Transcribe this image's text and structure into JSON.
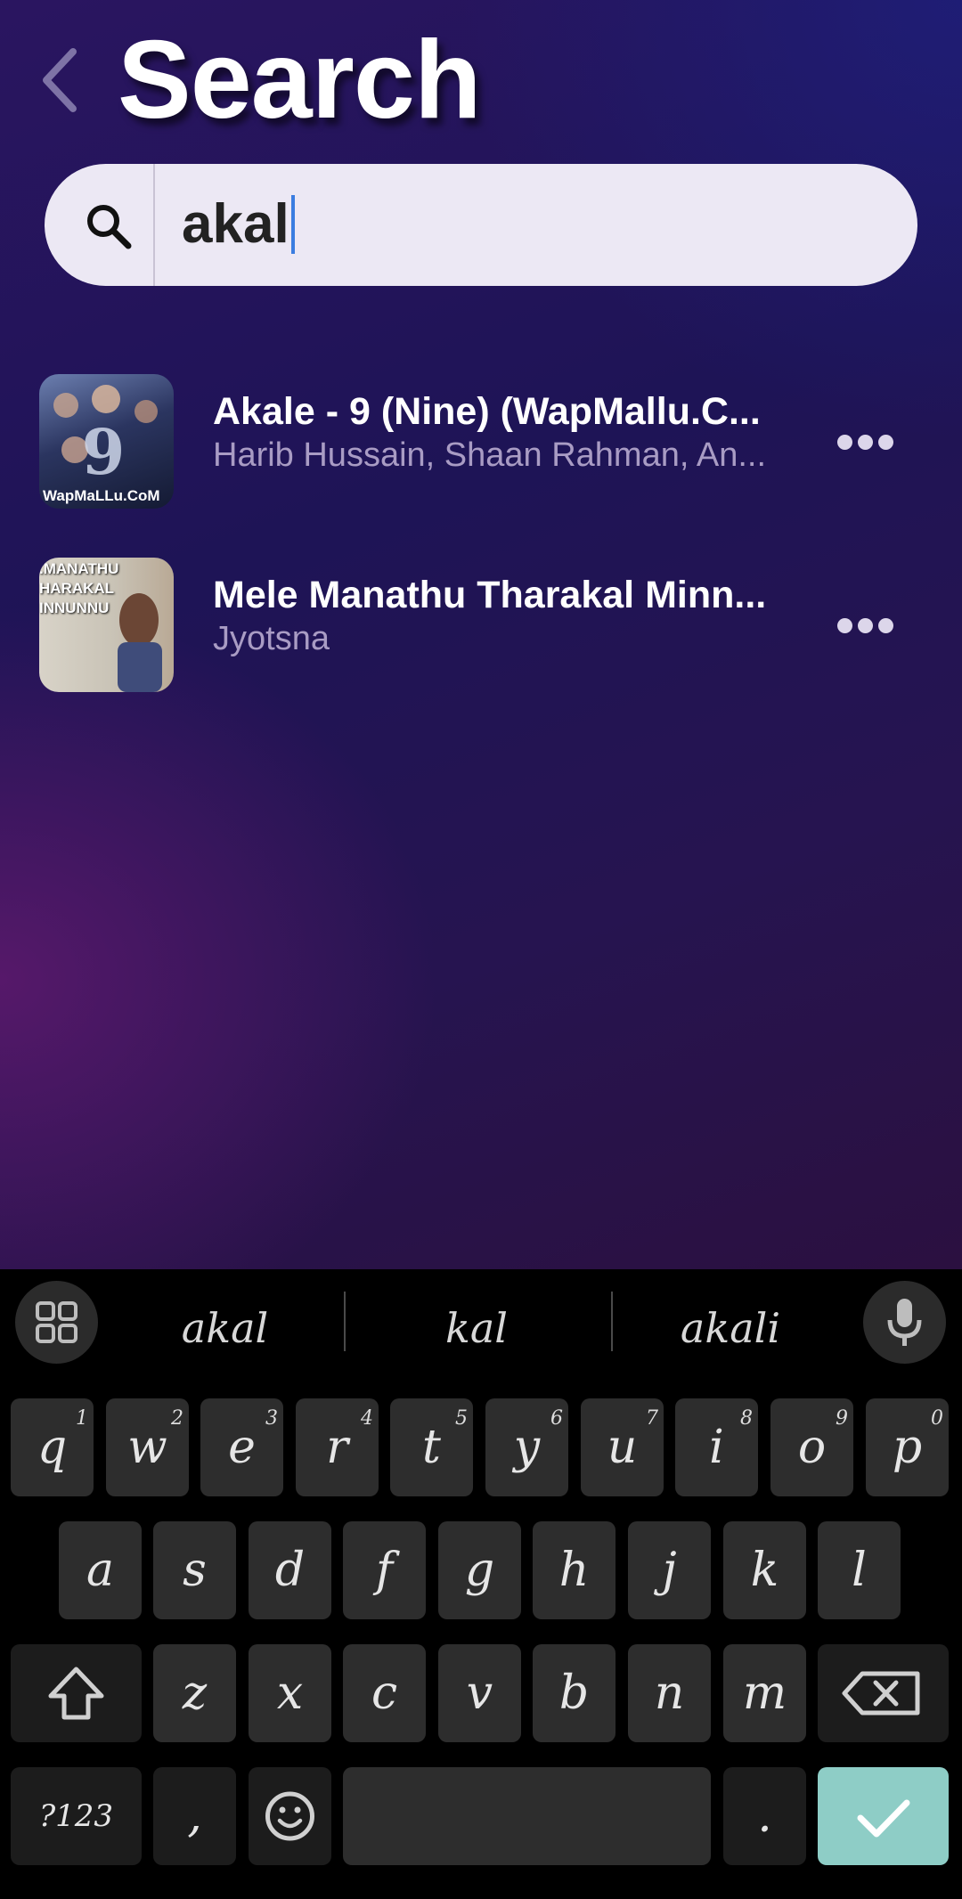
{
  "header": {
    "title": "Search"
  },
  "search": {
    "value": "akal"
  },
  "results": [
    {
      "title": "Akale - 9 (Nine) (WapMallu.C...",
      "subtitle": "Harib Hussain, Shaan Rahman, An...",
      "thumb_text": "WapMaLLu.CoM"
    },
    {
      "title": "Mele Manathu Tharakal Minn...",
      "subtitle": "Jyotsna",
      "thumb_text": ".MANATHU\nHARAKAL\nINNUNNU"
    }
  ],
  "keyboard": {
    "suggestions": [
      "akal",
      "kal",
      "akali"
    ],
    "row1": [
      {
        "k": "q",
        "n": "1"
      },
      {
        "k": "w",
        "n": "2"
      },
      {
        "k": "e",
        "n": "3"
      },
      {
        "k": "r",
        "n": "4"
      },
      {
        "k": "t",
        "n": "5"
      },
      {
        "k": "y",
        "n": "6"
      },
      {
        "k": "u",
        "n": "7"
      },
      {
        "k": "i",
        "n": "8"
      },
      {
        "k": "o",
        "n": "9"
      },
      {
        "k": "p",
        "n": "0"
      }
    ],
    "row2": [
      "a",
      "s",
      "d",
      "f",
      "g",
      "h",
      "j",
      "k",
      "l"
    ],
    "row3": [
      "z",
      "x",
      "c",
      "v",
      "b",
      "n",
      "m"
    ],
    "symbols_label": "?123",
    "comma": ",",
    "period": ".",
    "accent_color": "#8ecdc6"
  }
}
